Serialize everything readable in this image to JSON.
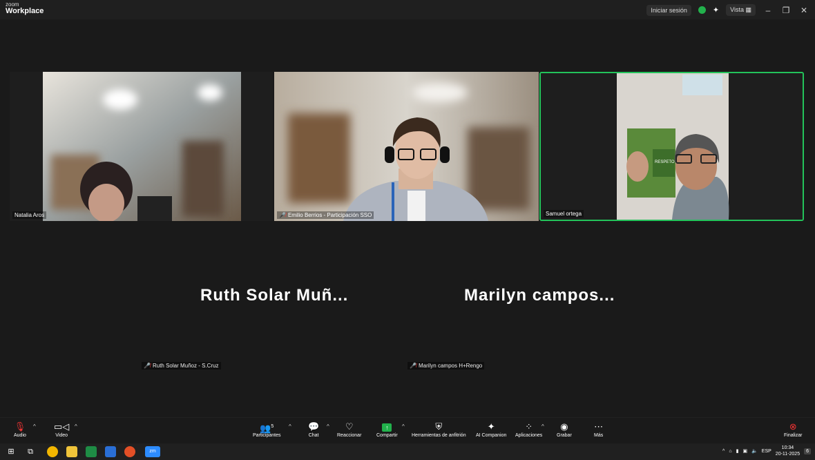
{
  "titlebar": {
    "logo_top": "zoom",
    "logo_bottom": "Workplace",
    "signin": "Iniciar sesión",
    "view": "Vista"
  },
  "tiles": [
    {
      "name": "Natalia Aros"
    },
    {
      "name": "Emilio Berrios - Participación SSO"
    },
    {
      "name": "Samuel ortega"
    }
  ],
  "audio_only": [
    {
      "big": "Ruth Solar Muñ...",
      "small": "Ruth Solar Muñoz - S.Cruz"
    },
    {
      "big": "Marilyn campos...",
      "small": "Marilyn campos H+Rengo"
    }
  ],
  "toolbar": {
    "audio": "Audio",
    "video": "Video",
    "participants": "Participantes",
    "participants_count": "5",
    "chat": "Chat",
    "react": "Reaccionar",
    "share": "Compartir",
    "host_tools": "Herramientas de anfitrión",
    "ai": "AI Companion",
    "apps": "Aplicaciones",
    "record": "Grabar",
    "more": "Más",
    "end": "Finalizar"
  },
  "taskbar": {
    "lang": "ESP",
    "time": "10:34",
    "date": "20-11-2025",
    "notif": "6",
    "zoom_app": "zm"
  }
}
